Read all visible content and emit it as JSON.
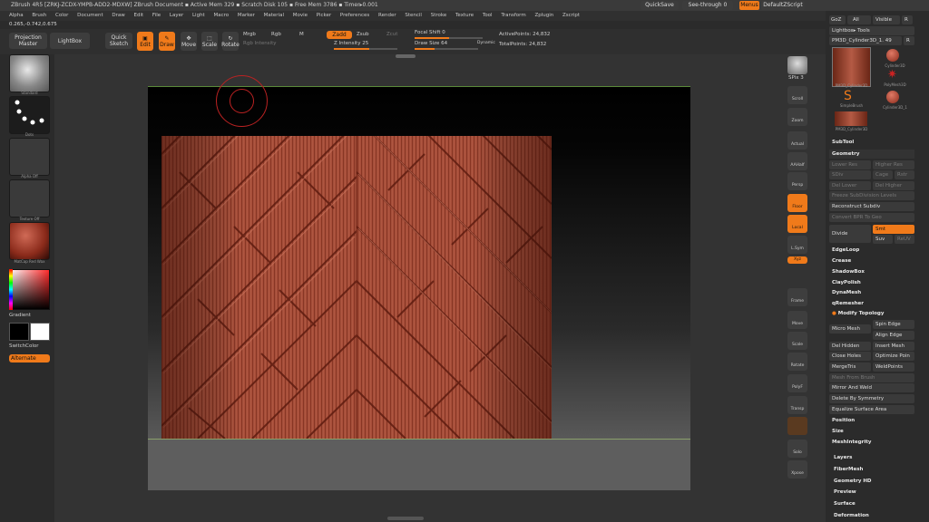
{
  "title_bar": {
    "text": "ZBrush 4R5  [ZRKJ-ZCDX-YMPB-ADD2-MDXW]   ZBrush Document      ▪ Active Mem 329 ▪ Scratch Disk 105 ▪ Free Mem 3786 ▪ Timer▸0.001",
    "quicksave": "QuickSave",
    "see_through": "See-through  0",
    "menus": "Menus",
    "default_script": "DefaultZScript"
  },
  "menu_bar": [
    "Alpha",
    "Brush",
    "Color",
    "Document",
    "Draw",
    "Edit",
    "File",
    "Layer",
    "Light",
    "Macro",
    "Marker",
    "Material",
    "Movie",
    "Picker",
    "Preferences",
    "Render",
    "Stencil",
    "Stroke",
    "Texture",
    "Tool",
    "Transform",
    "Zplugin",
    "Zscript"
  ],
  "coords": "0.265,-0.742,0.675",
  "toolbar": {
    "projection_master": "Projection Master",
    "lightbox": "LightBox",
    "quick_sketch": "Quick Sketch",
    "edit": "Edit",
    "draw": "Draw",
    "move": "Move",
    "scale": "Scale",
    "rotate": "Rotate",
    "mrgb": "Mrgb",
    "rgb": "Rgb",
    "m": "M",
    "rgb_intensity": "Rgb Intensity",
    "zadd": "Zadd",
    "zsub": "Zsub",
    "zcut": "Zcut",
    "z_intensity": "Z Intensity 25",
    "focal_shift": "Focal Shift 0",
    "draw_size": "Draw Size 64",
    "dynamic": "Dynamic",
    "active_points": "ActivePoints: 24,832",
    "total_points": "TotalPoints: 24,832"
  },
  "left_panel": {
    "standard": "Standard",
    "dots": "Dots",
    "alpha_off": "Alpha Off",
    "texture_off": "Texture Off",
    "matcap": "MatCap Red Wax",
    "gradient": "Gradient",
    "switch_color": "SwitchColor",
    "alternate": "Alternate"
  },
  "right_toolbar": [
    "BPR",
    "SPix 3",
    "Scroll",
    "Zoom",
    "Actual",
    "AAHalf",
    "Persp",
    "Floor",
    "Local",
    "L.Sym",
    "Xyz",
    "",
    "Frame",
    "Move",
    "Scale",
    "Rotate",
    "PolyF",
    "Transp",
    "",
    "Solo",
    "Xpose"
  ],
  "right_panel": {
    "top_buttons": [
      "GoZ",
      "All",
      "Visible",
      "R"
    ],
    "lightbox_tools": "Lightbox▸ Tools",
    "current_tool": "PM3D_Cylinder3D_1. 49",
    "current_tool_r": "R",
    "tools": [
      {
        "label": "PM3D_Cylinder3D"
      },
      {
        "label": "Cylinder3D"
      },
      {
        "label": "PolyMesh3D"
      },
      {
        "label": "SimpleBrush"
      },
      {
        "label": "Cylinder3D_1"
      },
      {
        "label": "PM3D_Cylinder3D"
      }
    ],
    "subtool": "SubTool",
    "geometry": "Geometry",
    "lower_res": "Lower Res",
    "higher_res": "Higher Res",
    "sdiv": "SDiv",
    "cage": "Cage",
    "rstr": "Rstr",
    "del_lower": "Del Lower",
    "del_higher": "Del Higher",
    "freeze": "Freeze SubDivision Levels",
    "reconstruct": "Reconstruct Subdiv",
    "convert_bpr": "Convert BPR To Geo",
    "divide": "Divide",
    "smt": "Smt",
    "suv": "Suv",
    "reuv": "ReUV",
    "edgeloop": "EdgeLoop",
    "crease": "Crease",
    "shadowbox": "ShadowBox",
    "claypolish": "ClayPolish",
    "dynamesh": "DynaMesh",
    "qremesher": "qRemesher",
    "modify_topology": "Modify Topology",
    "spin_edge": "Spin Edge",
    "micro_mesh": "Micro Mesh",
    "align_edge": "Align Edge",
    "del_hidden": "Del Hidden",
    "insert_mesh": "Insert Mesh",
    "close_holes": "Close Holes",
    "optimize_points": "Optimize Poin",
    "mergetris": "MergeTris",
    "weldpoints": "WeldPoints",
    "mesh_from_brush": "Mesh From Brush",
    "mirror_and_weld": "Mirror And Weld",
    "delete_by_symmetry": "Delete By Symmetry",
    "equalize": "Equalize Surface Area",
    "position": "Position",
    "size": "Size",
    "meshintegrity": "MeshIntegrity",
    "layers": "Layers",
    "fibermesh": "FiberMesh",
    "geometry_hd": "Geometry HD",
    "preview": "Preview",
    "surface": "Surface",
    "deformation": "Deformation"
  },
  "colors": {
    "accent": "#f07a1a",
    "cylinder": "#a54a36",
    "background": "#2b2b2b"
  }
}
